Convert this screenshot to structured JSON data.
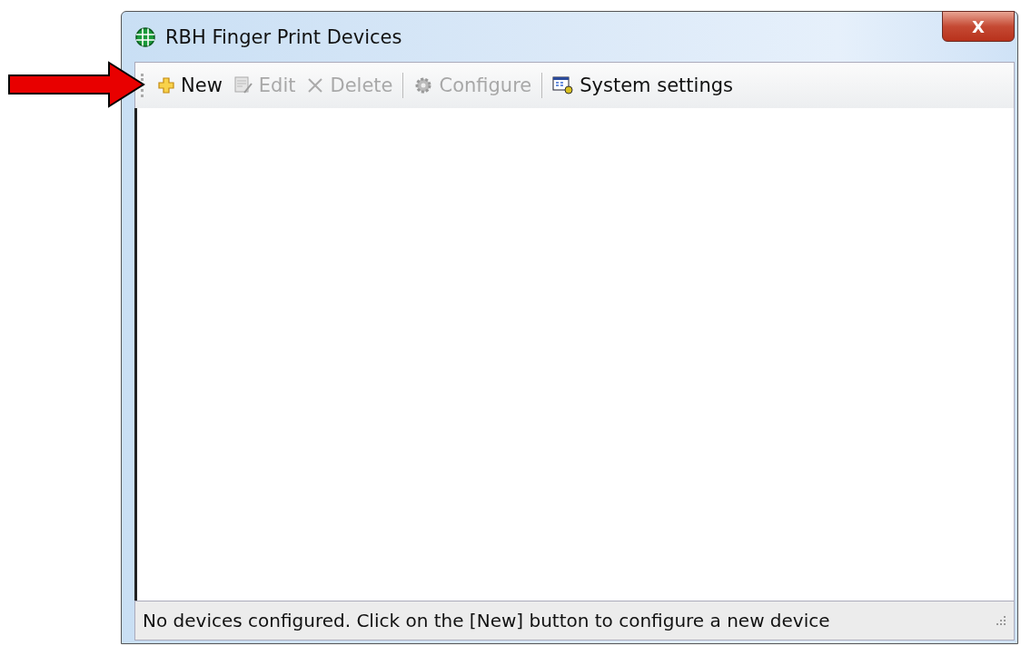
{
  "window": {
    "title": "RBH Finger Print Devices",
    "close": "X"
  },
  "toolbar": [
    {
      "kind": "new",
      "label": "New",
      "disabled": false,
      "separator_before": false
    },
    {
      "kind": "edit",
      "label": "Edit",
      "disabled": true,
      "separator_before": false
    },
    {
      "kind": "delete",
      "label": "Delete",
      "disabled": true,
      "separator_before": false
    },
    {
      "kind": "configure",
      "label": "Configure",
      "disabled": true,
      "separator_before": true
    },
    {
      "kind": "settings",
      "label": "System settings",
      "disabled": false,
      "separator_before": true
    }
  ],
  "status_bar": {
    "text": "No devices configured. Click on the [New] button to configure a new device"
  }
}
